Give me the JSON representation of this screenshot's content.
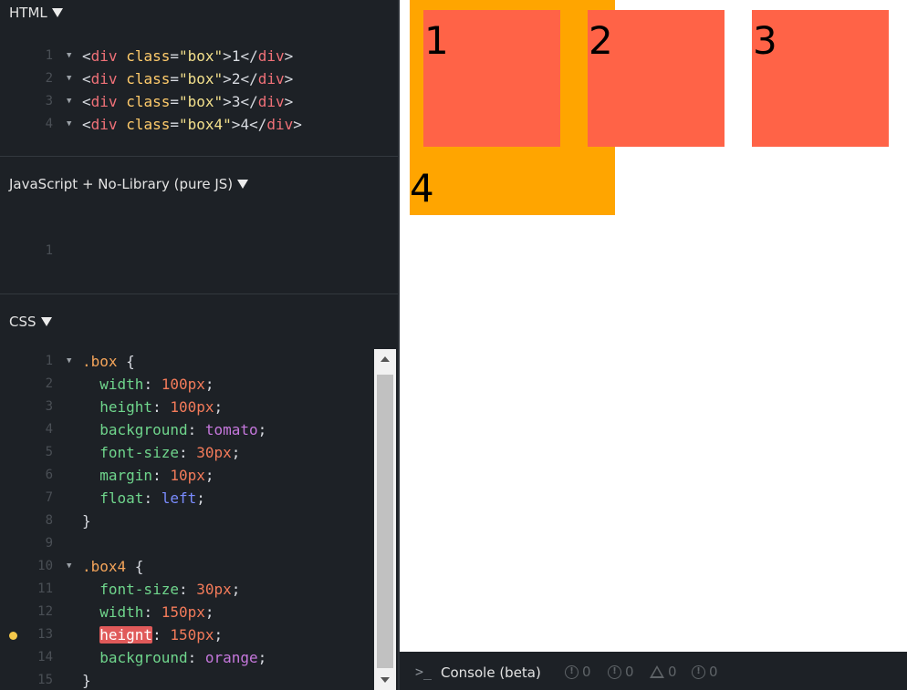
{
  "panels": {
    "html": {
      "title": "HTML"
    },
    "js": {
      "title": "JavaScript + No-Library (pure JS)"
    },
    "css": {
      "title": "CSS"
    }
  },
  "html_code": [
    {
      "n": "1",
      "open": "<",
      "tag": "div",
      "attr": "class",
      "eq": "=",
      "str": "\"box\"",
      "close": ">",
      "content": "1",
      "end_open": "</",
      "end_tag": "div",
      "end_close": ">"
    },
    {
      "n": "2",
      "open": "<",
      "tag": "div",
      "attr": "class",
      "eq": "=",
      "str": "\"box\"",
      "close": ">",
      "content": "2",
      "end_open": "</",
      "end_tag": "div",
      "end_close": ">"
    },
    {
      "n": "3",
      "open": "<",
      "tag": "div",
      "attr": "class",
      "eq": "=",
      "str": "\"box\"",
      "close": ">",
      "content": "3",
      "end_open": "</",
      "end_tag": "div",
      "end_close": ">"
    },
    {
      "n": "4",
      "open": "<",
      "tag": "div",
      "attr": "class",
      "eq": "=",
      "str": "\"box4\"",
      "close": ">",
      "content": "4",
      "end_open": "</",
      "end_tag": "div",
      "end_close": ">"
    }
  ],
  "js_code": [
    {
      "n": "1"
    }
  ],
  "css_code": {
    "n": [
      "1",
      "2",
      "3",
      "4",
      "5",
      "6",
      "7",
      "8",
      "9",
      "10",
      "11",
      "12",
      "13",
      "14",
      "15"
    ],
    "box_selector": ".box",
    "brace_open": " {",
    "brace_close": "}",
    "box4_selector": ".box4",
    "rules_box": [
      {
        "prop": "width",
        "val": "100px",
        "kind": "num"
      },
      {
        "prop": "height",
        "val": "100px",
        "kind": "num"
      },
      {
        "prop": "background",
        "val": "tomato",
        "kind": "kw"
      },
      {
        "prop": "font-size",
        "val": "30px",
        "kind": "num"
      },
      {
        "prop": "margin",
        "val": "10px",
        "kind": "num"
      },
      {
        "prop": "float",
        "val": "left",
        "kind": "blue"
      }
    ],
    "rules_box4": [
      {
        "prop": "font-size",
        "val": "30px",
        "kind": "num"
      },
      {
        "prop": "width",
        "val": "150px",
        "kind": "num"
      },
      {
        "prop": "heignt",
        "val": "150px",
        "kind": "num",
        "error": true
      },
      {
        "prop": "background",
        "val": "orange",
        "kind": "kw"
      }
    ]
  },
  "result": {
    "box1": "1",
    "box2": "2",
    "box3": "3",
    "box4": "4"
  },
  "console": {
    "prompt": ">_",
    "label": "Console (beta)",
    "counts": [
      "0",
      "0",
      "0",
      "0"
    ]
  }
}
